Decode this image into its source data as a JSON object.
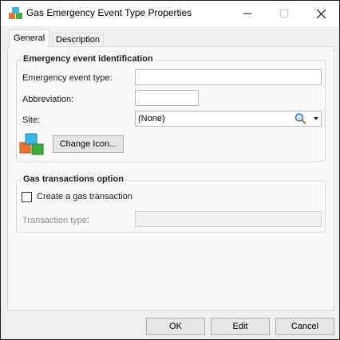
{
  "window": {
    "title": "Gas Emergency Event Type Properties"
  },
  "tabs": [
    {
      "label": "General",
      "active": true
    },
    {
      "label": "Description",
      "active": false
    }
  ],
  "identification": {
    "group_title": "Emergency event identification",
    "event_type_label": "Emergency event type:",
    "event_type_value": "",
    "abbreviation_label": "Abbreviation:",
    "abbreviation_value": "",
    "site_label": "Site:",
    "site_value": "(None)",
    "change_icon_label": "Change Icon..."
  },
  "transactions": {
    "group_title": "Gas transactions option",
    "create_label": "Create a gas transaction",
    "create_checked": false,
    "type_label": "Transaction type:",
    "type_value": ""
  },
  "footer": {
    "ok_label": "OK",
    "edit_label": "Edit",
    "cancel_label": "Cancel"
  },
  "icons": {
    "app": "colored-cubes-icon",
    "search": "magnifier-icon",
    "dropdown": "chevron-down-icon",
    "minimize": "minimize-icon",
    "maximize": "maximize-icon",
    "close": "close-icon"
  }
}
